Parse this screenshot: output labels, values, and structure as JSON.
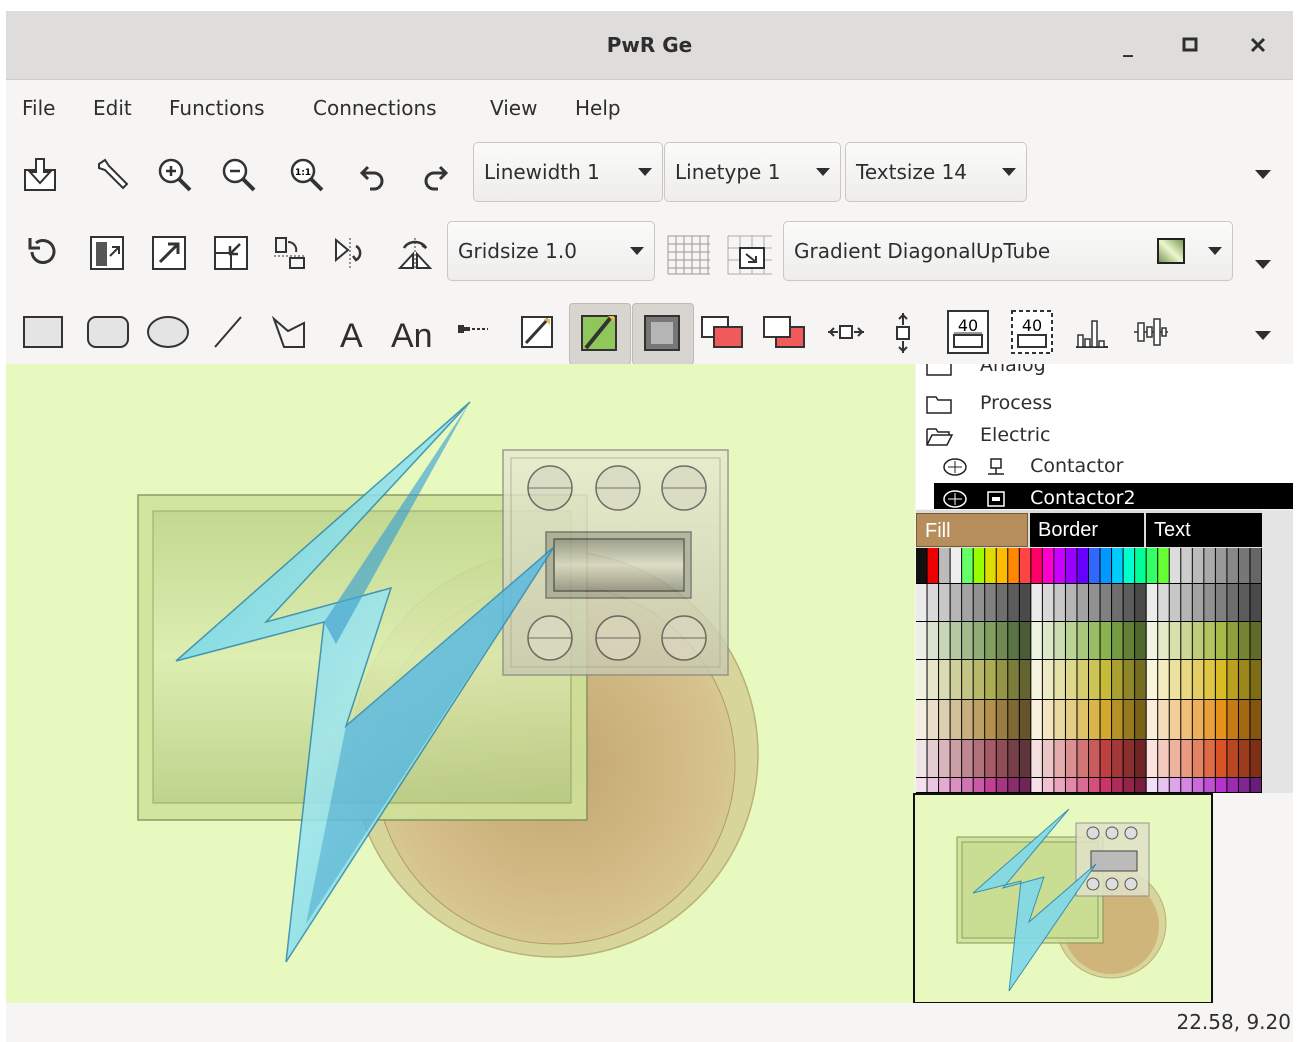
{
  "window": {
    "title": "PwR Ge",
    "minimize_label": "_",
    "maximize_label": "□",
    "close_label": "✕"
  },
  "menubar": {
    "items": [
      "File",
      "Edit",
      "Functions",
      "Connections",
      "View",
      "Help"
    ]
  },
  "toolbar1": {
    "icons": [
      "save-icon",
      "tools-icon",
      "zoom-in-icon",
      "zoom-out-icon",
      "zoom-reset-icon",
      "undo-icon",
      "redo-icon"
    ],
    "linewidth": "Linewidth 1",
    "linetype": "Linetype 1",
    "textsize": "Textsize 14"
  },
  "toolbar2": {
    "icons": [
      "rotate-icon",
      "align-top-icon",
      "align-right-icon",
      "align-corner-icon",
      "mirror-vertical-icon",
      "mirror-horizontal-icon",
      "flip-icon"
    ],
    "gridsize": "Gridsize 1.0",
    "gradient": "Gradient DiagonalUpTube"
  },
  "toolbar3": {
    "tools": [
      "rectangle-tool-icon",
      "rounded-rect-tool-icon",
      "ellipse-tool-icon",
      "line-tool-icon",
      "polyline-tool-icon",
      "text-tool-icon",
      "annotation-tool-icon",
      "connection-tool-icon",
      "border-icon",
      "fill-icon",
      "shadow-icon",
      "push-front-icon",
      "push-back-icon",
      "hdistribute-icon",
      "vdistribute-icon",
      "group-icon",
      "ungroup-icon",
      "bar-chart-icon",
      "trend-icon"
    ],
    "text_tool_label": "A",
    "annotation_tool_label": "An"
  },
  "tree": {
    "partial_top": "Analog",
    "items": [
      {
        "label": "Process",
        "icon": "folder-closed-icon",
        "selected": false
      },
      {
        "label": "Electric",
        "icon": "folder-open-icon",
        "selected": false
      },
      {
        "label": "Contactor",
        "icon": "component-icon",
        "selected": false
      },
      {
        "label": "Contactor2",
        "icon": "component-icon",
        "selected": true
      }
    ]
  },
  "palette_tabs": {
    "fill": "Fill",
    "border": "Border",
    "text": "Text"
  },
  "status": {
    "coords": "22.58,  9.20"
  },
  "colors": {
    "canvas_bg": "#e7f9bf",
    "selected_tab": "#b58e5c",
    "selection_bg": "#000000"
  }
}
